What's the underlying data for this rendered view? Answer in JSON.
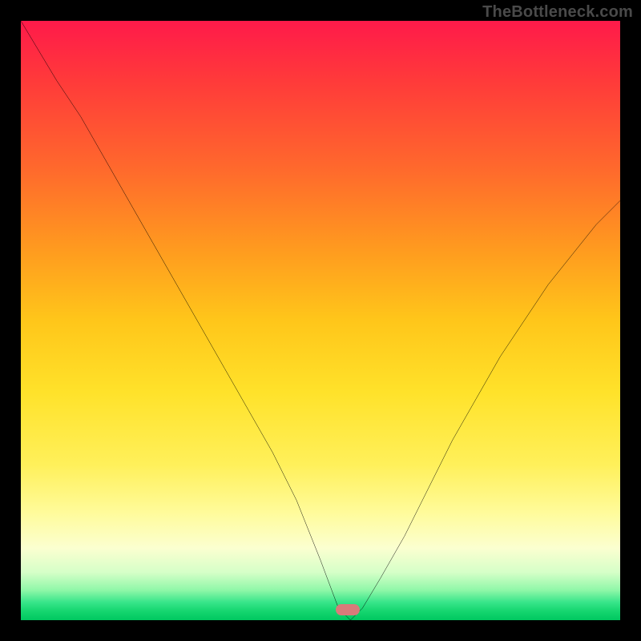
{
  "watermark": "TheBottleneck.com",
  "marker": {
    "x_pct": 54.5,
    "y_pct": 98.2
  },
  "chart_data": {
    "type": "line",
    "title": "",
    "xlabel": "",
    "ylabel": "",
    "xlim": [
      0,
      100
    ],
    "ylim": [
      0,
      100
    ],
    "grid": false,
    "legend": false,
    "series": [
      {
        "name": "bottleneck-curve",
        "x": [
          0,
          3,
          6,
          10,
          14,
          18,
          22,
          26,
          30,
          34,
          38,
          42,
          46,
          50,
          53,
          55,
          57,
          60,
          64,
          68,
          72,
          76,
          80,
          84,
          88,
          92,
          96,
          100
        ],
        "y": [
          100,
          95,
          90,
          84,
          77,
          70,
          63,
          56,
          49,
          42,
          35,
          28,
          20,
          10,
          2,
          0,
          2,
          7,
          14,
          22,
          30,
          37,
          44,
          50,
          56,
          61,
          66,
          70
        ]
      }
    ],
    "annotations": [
      {
        "type": "marker",
        "shape": "rounded-rect",
        "x": 54.5,
        "y": 1.8,
        "color": "#d87b7a"
      }
    ],
    "background_gradient": {
      "direction": "vertical",
      "stops": [
        {
          "pct": 0,
          "color": "#ff1a4a"
        },
        {
          "pct": 50,
          "color": "#ffc61a"
        },
        {
          "pct": 88,
          "color": "#fbffd0"
        },
        {
          "pct": 100,
          "color": "#00c760"
        }
      ]
    }
  }
}
